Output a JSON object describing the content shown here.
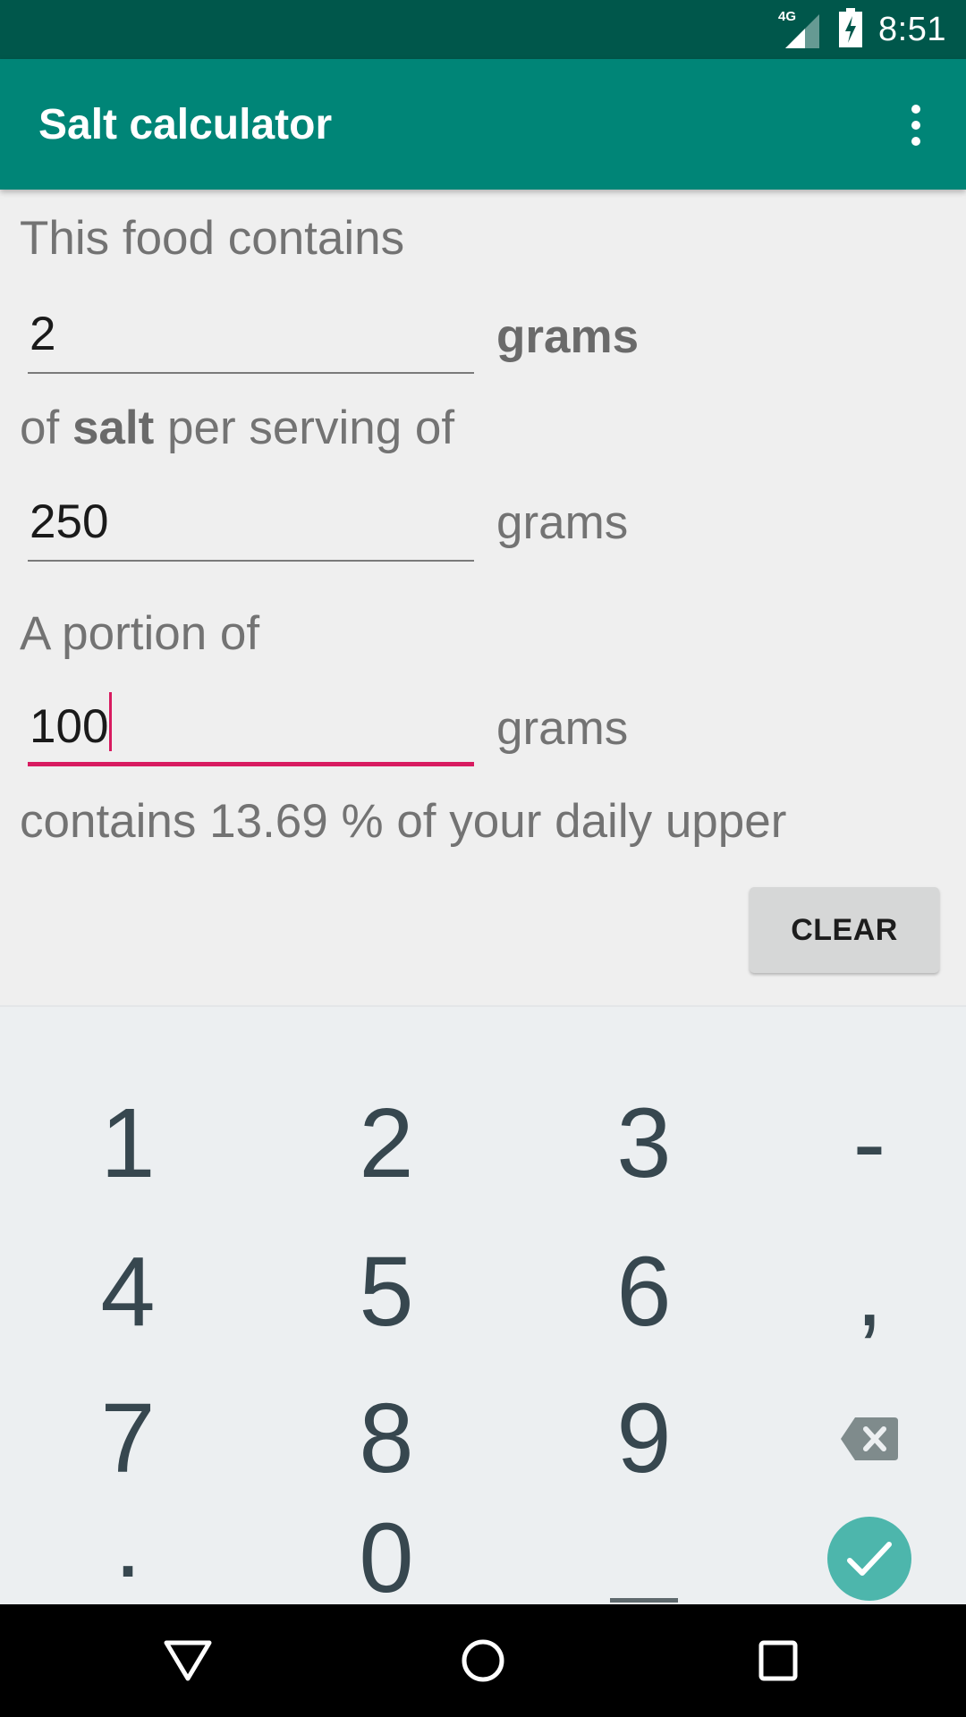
{
  "status_bar": {
    "network": "4G",
    "time": "8:51",
    "icons": [
      "signal-icon",
      "battery-charging-icon"
    ]
  },
  "app_bar": {
    "title": "Salt calculator",
    "overflow_icon": "more-vert-icon"
  },
  "form": {
    "intro_label": "This food contains",
    "salt_amount": {
      "value": "2",
      "unit": "grams"
    },
    "salt_label_prefix": "of ",
    "salt_label_bold": "salt",
    "salt_label_suffix": " per serving of",
    "serving_size": {
      "value": "250",
      "unit": "grams"
    },
    "portion_label": "A portion of",
    "portion_size": {
      "value": "100",
      "unit": "grams"
    },
    "result_text": "contains 13.69 % of your daily upper",
    "clear_button": "CLEAR"
  },
  "keyboard": {
    "rows": [
      [
        "1",
        "2",
        "3",
        "-"
      ],
      [
        "4",
        "5",
        "6",
        ","
      ],
      [
        "7",
        "8",
        "9",
        "backspace"
      ],
      [
        ".",
        "0",
        "_",
        "done"
      ]
    ],
    "accent_color": "#4db6ac"
  },
  "nav_bar": {
    "buttons": [
      "back",
      "home",
      "recents"
    ]
  },
  "colors": {
    "primary": "#008577",
    "primary_dark": "#00574b",
    "accent": "#d81b60"
  }
}
